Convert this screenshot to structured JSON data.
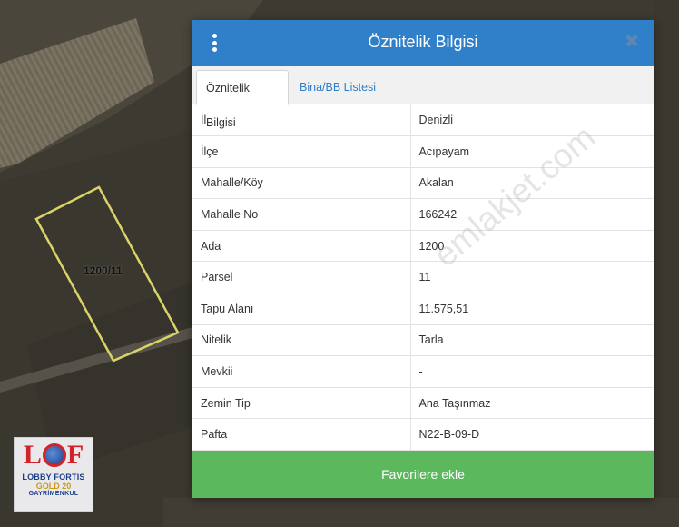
{
  "map": {
    "parcel_label": "1200/11",
    "parcel_outline_color": "#d9d36a"
  },
  "logo": {
    "mark_left": "L",
    "mark_right": "F",
    "line1": "LOBBY FORTIS",
    "line2": "GOLD 20",
    "line3": "GAYRİMENKUL"
  },
  "panel": {
    "title": "Öznitelik Bilgisi",
    "header_color": "#2f7fc9",
    "menu_icon": "vertical-dots-icon",
    "close_icon": "close-icon",
    "tabs": [
      {
        "label": "Öznitelik Bilgisi",
        "active": true
      },
      {
        "label": "Bina/BB Listesi",
        "active": false
      }
    ],
    "rows": [
      {
        "key": "İl",
        "value": "Denizli"
      },
      {
        "key": "İlçe",
        "value": "Acıpayam"
      },
      {
        "key": "Mahalle/Köy",
        "value": "Akalan"
      },
      {
        "key": "Mahalle No",
        "value": "166242"
      },
      {
        "key": "Ada",
        "value": "1200"
      },
      {
        "key": "Parsel",
        "value": "11"
      },
      {
        "key": "Tapu Alanı",
        "value": "11.575,51"
      },
      {
        "key": "Nitelik",
        "value": "Tarla"
      },
      {
        "key": "Mevkii",
        "value": "-"
      },
      {
        "key": "Zemin Tip",
        "value": "Ana Taşınmaz"
      },
      {
        "key": "Pafta",
        "value": "N22-B-09-D"
      }
    ],
    "button_label": "Favorilere ekle",
    "button_color": "#5cb85c"
  },
  "watermark": "emlakjet.com"
}
